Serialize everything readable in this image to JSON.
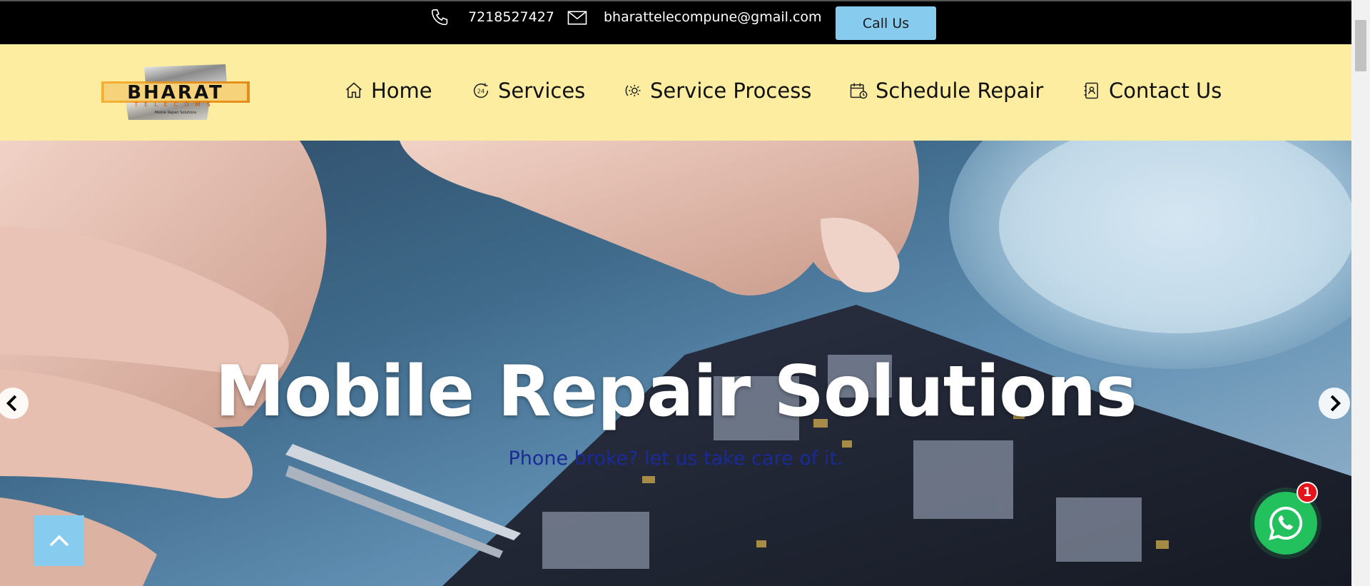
{
  "topbar": {
    "phone_icon": "phone-icon",
    "phone": "7218527427",
    "email_icon": "envelope-icon",
    "email": "bharattelecompune@gmail.com",
    "call_button": "Call Us"
  },
  "brand": {
    "logo_text": "BHARAT",
    "logo_subtext": "TELECOMS",
    "logo_tagline": "Mobile Repair Solutions"
  },
  "nav": {
    "items": [
      {
        "label": "Home",
        "icon": "home-icon"
      },
      {
        "label": "Services",
        "icon": "24h-service-icon"
      },
      {
        "label": "Service Process",
        "icon": "gear-process-icon"
      },
      {
        "label": "Schedule Repair",
        "icon": "calendar-icon"
      },
      {
        "label": "Contact Us",
        "icon": "contact-book-icon"
      }
    ]
  },
  "hero": {
    "title": "Mobile Repair Solutions",
    "subtitle": "Phone broke? let us take care of it."
  },
  "whatsapp": {
    "badge_count": "1"
  },
  "colors": {
    "topbar_bg": "#000000",
    "navbar_bg": "#fdeda0",
    "accent": "#87cbee",
    "whatsapp": "#22c15e",
    "badge": "#e4141b",
    "subtitle": "#1a2a99"
  }
}
